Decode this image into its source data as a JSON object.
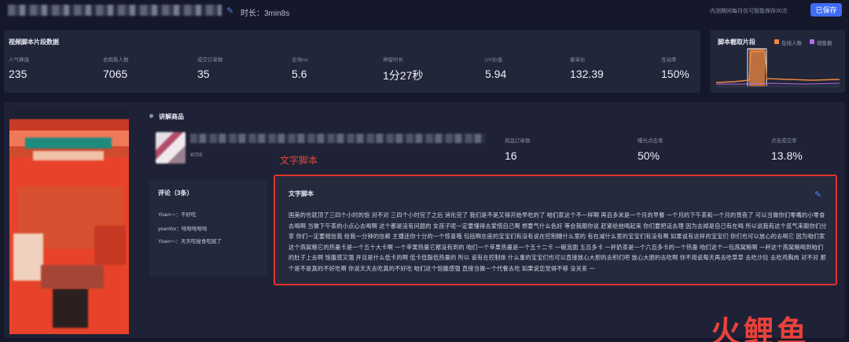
{
  "header": {
    "duration_label": "时长：3min8s",
    "notice": "内测期间每月仅可智能保存30次",
    "save_label": "已保存"
  },
  "stats": {
    "title": "视频脚本片段数据",
    "metrics": [
      {
        "label": "人气峰值",
        "value": "235"
      },
      {
        "label": "总观看人数",
        "value": "7065"
      },
      {
        "label": "成交订单数",
        "value": "35"
      },
      {
        "label": "全场roi",
        "value": "5.6"
      },
      {
        "label": "停留时长",
        "value": "1分27秒"
      },
      {
        "label": "UV价值",
        "value": "5.94"
      },
      {
        "label": "客单价",
        "value": "132.39"
      },
      {
        "label": "互动率",
        "value": "150%"
      }
    ]
  },
  "mini_chart": {
    "title": "脚本截取片段",
    "legend": [
      {
        "name": "在线人数",
        "color": "#f0893f"
      },
      {
        "name": "销售额",
        "color": "#b56be6"
      }
    ]
  },
  "product": {
    "section_title": "讲解商品",
    "price": "¥256",
    "metrics": [
      {
        "label": "商品订单数",
        "value": "16"
      },
      {
        "label": "曝光点击率",
        "value": "50%"
      },
      {
        "label": "点击成交率",
        "value": "13.8%"
      }
    ]
  },
  "annotation": "文字脚本",
  "comments": {
    "title": "评论（3条）",
    "items": [
      {
        "user": "Yisen～",
        "text": "不好吃"
      },
      {
        "user": "yeamfor",
        "text": "哈哈哈哈哈"
      },
      {
        "user": "Yisen～",
        "text": "天天吃秘食吃腻了"
      }
    ]
  },
  "script": {
    "title": "文字脚本",
    "text": "国美的也就顶了三四个小时的饱 对不对 三四个小时完了之后 消化完了 我们是不是又得开始早吃的了 咱们家这个不一样啊 再百多米是一个月的早餐 一个月的下午茶和一个月的宵夜了 可以当做你们零嘴的小零食去喝啊 当做下午茶的小点心去喝啊 这个都是没有问题的 女孩子呢一定要懂得去爱惜自己啊 想要气什么色好 等会我跟你说 赶紧给他喝起来 你们要把话去理 因为去掉是自己有在喝 所以说我有这个底气来跟你们分享 你们一定要相信我 给我一分钟的信赖 主播还你十分的一个惊喜哦 包括啊在座的宝宝们有没有说在控制糖什么里的 有在减什么里的宝宝们有没有啊 如果说有这样的宝宝们 你们也可以放心的去喝它 因为咱们家这个燕窝粮它的热量卡是一个五十大卡啊 一个苹果热量它都没有到的 咱们一个苹果热量是一个五十二卡 一碗泡面 五百多卡 一杯奶茶是一个六百多卡的一个热量 咱们这个一包燕窝粮啊 一杯这个燕窝粮喝到咱们的肚子上去啊 饱腹感又强 并且是什么低卡的啊 低卡低脂低热量的 所以 说有在控制体 什么重的宝宝们也可以直接放心大胆的去积们吧 放心大胆的去吃啊 你不用说每天再去吃草草 去吃沙拉 去吃鸡胸肉 对不对 那个是不是真的不好吃啊 你说天天去吃真的不好吃 咱们这个饱腹感强 直接当做一个代餐去吃 如果说您觉得不够 没关系 一"
  },
  "watermark": {
    "text": "火鲤鱼"
  }
}
